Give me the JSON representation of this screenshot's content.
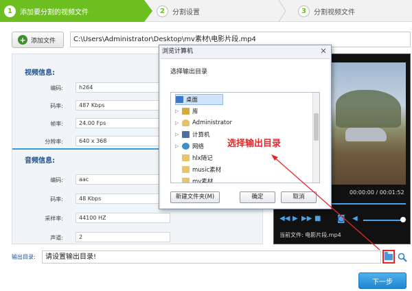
{
  "steps": [
    {
      "num": "1",
      "label": "添加要分割的视频文件"
    },
    {
      "num": "2",
      "label": "分割设置"
    },
    {
      "num": "3",
      "label": "分割视频文件"
    }
  ],
  "toolbar": {
    "add_label": "添加文件",
    "file_path": "C:\\Users\\Administrator\\Desktop\\mv素材\\电影片段.mp4"
  },
  "video_info": {
    "title": "视频信息:",
    "rows": [
      {
        "label": "编码:",
        "value": "h264"
      },
      {
        "label": "码率:",
        "value": "487 Kbps"
      },
      {
        "label": "帧率:",
        "value": "24.00 Fps"
      },
      {
        "label": "分辨率:",
        "value": "640 x 368"
      }
    ]
  },
  "audio_info": {
    "title": "音频信息:",
    "rows": [
      {
        "label": "编码:",
        "value": "aac"
      },
      {
        "label": "码率:",
        "value": "48 Kbps"
      },
      {
        "label": "采样率:",
        "value": "44100 HZ"
      },
      {
        "label": "声道:",
        "value": "2"
      }
    ]
  },
  "player": {
    "timecode": "00:00:00 / 00:01:52",
    "current_file": "当前文件: 电影片段.mp4",
    "progress": 0.0
  },
  "output": {
    "label": "输出目录:",
    "value": "请设置输出目录!"
  },
  "next_label": "下一步",
  "dialog": {
    "title": "浏览计算机",
    "close_glyph": "✕",
    "prompt": "选择输出目录",
    "tree": [
      {
        "label": "桌面",
        "icon": "desktop-icon"
      },
      {
        "label": "库",
        "icon": "library-icon"
      },
      {
        "label": "Administrator",
        "icon": "user-icon"
      },
      {
        "label": "计算机",
        "icon": "computer-icon"
      },
      {
        "label": "网络",
        "icon": "network-icon"
      },
      {
        "label": "hlx随记",
        "icon": "folder-icon"
      },
      {
        "label": "music素材",
        "icon": "folder-icon"
      },
      {
        "label": "mv素材",
        "icon": "folder-icon"
      }
    ],
    "buttons": {
      "new_folder": "新建文件夹(M)",
      "ok": "确定",
      "cancel": "取消"
    }
  },
  "annotation": "选择输出目录",
  "colors": {
    "accent_green": "#6cbf1f",
    "accent_blue": "#3a9ad9",
    "callout_red": "#e5262b"
  }
}
